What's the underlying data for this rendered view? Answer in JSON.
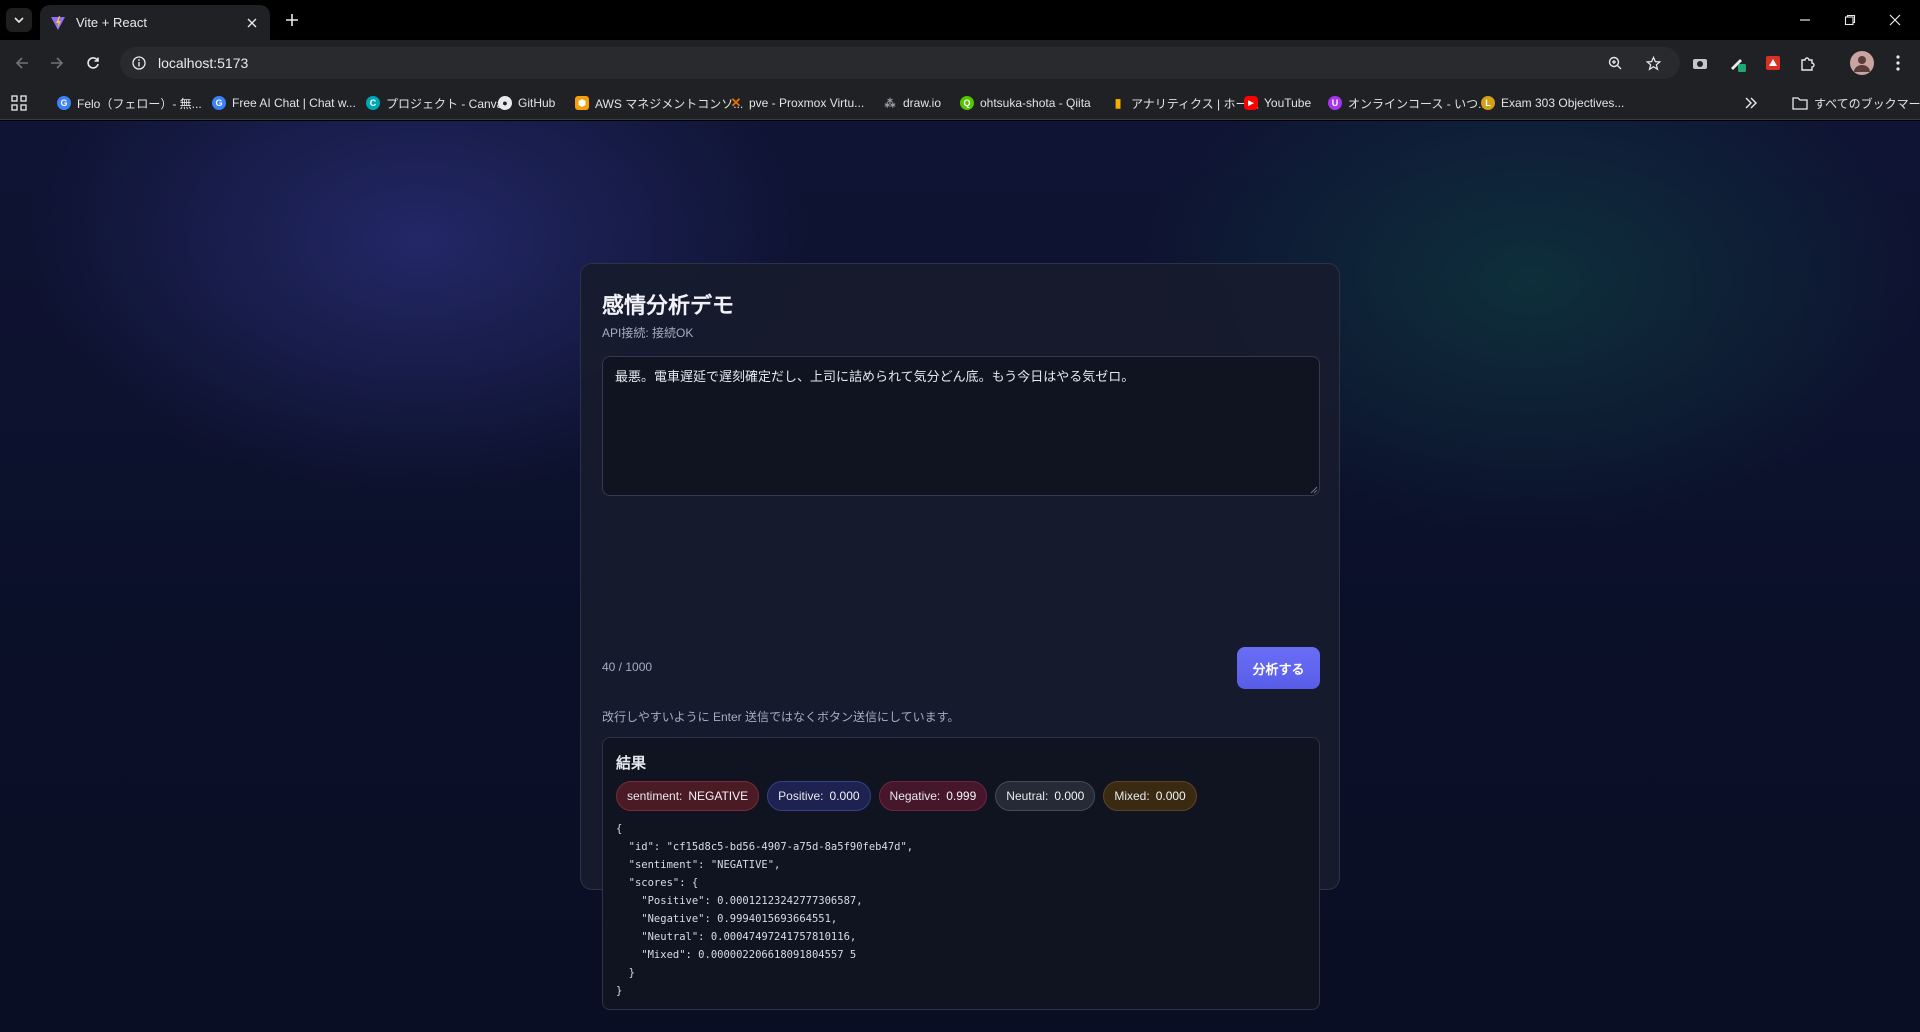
{
  "browser": {
    "tab_title": "Vite + React",
    "url": "localhost:5173",
    "bookmarks": [
      {
        "label": "Felo（フェロー）- 無...",
        "color": "#3b82f6",
        "glyph": "G"
      },
      {
        "label": "Free AI Chat | Chat w...",
        "color": "#3b82f6",
        "glyph": "G"
      },
      {
        "label": "プロジェクト - Canva",
        "color": "#00c4cc",
        "glyph": "C"
      },
      {
        "label": "GitHub",
        "color": "#ffffff",
        "glyph": "●"
      },
      {
        "label": "AWS マネジメントコンソ...",
        "color": "#f59e0b",
        "glyph": "⬢"
      },
      {
        "label": "pve - Proxmox Virtu...",
        "color": "#e57000",
        "glyph": "✕"
      },
      {
        "label": "draw.io",
        "color": "#9aa0a6",
        "glyph": "⁂"
      },
      {
        "label": "ohtsuka-shota - Qiita",
        "color": "#55c500",
        "glyph": "Q"
      },
      {
        "label": "アナリティクス | ホーム",
        "color": "#f9ab00",
        "glyph": "▮"
      },
      {
        "label": "YouTube",
        "color": "#ff0000",
        "glyph": "▶"
      },
      {
        "label": "オンラインコース - いつ...",
        "color": "#a435f0",
        "glyph": "U"
      },
      {
        "label": "Exam 303 Objectives...",
        "color": "#d4a017",
        "glyph": "L"
      }
    ],
    "all_bookmarks": "すべてのブックマーク"
  },
  "app": {
    "title": "感情分析デモ",
    "api_status": "API接続: 接続OK",
    "input_text": "最悪。電車遅延で遅刻確定だし、上司に詰められて気分どん底。もう今日はやる気ゼロ。",
    "counter": "40 / 1000",
    "analyze_label": "分析する",
    "hint": "改行しやすいように Enter 送信ではなくボタン送信にしています。"
  },
  "result": {
    "title": "結果",
    "chips": {
      "sentiment_label": "sentiment:",
      "sentiment_value": "NEGATIVE",
      "positive_label": "Positive:",
      "positive_value": "0.000",
      "negative_label": "Negative:",
      "negative_value": "0.999",
      "neutral_label": "Neutral:",
      "neutral_value": "0.000",
      "mixed_label": "Mixed:",
      "mixed_value": "0.000"
    },
    "json": "{\n  \"id\": \"cf15d8c5-bd56-4907-a75d-8a5f90feb47d\",\n  \"sentiment\": \"NEGATIVE\",\n  \"scores\": {\n    \"Positive\": 0.00012123242777306587,\n    \"Negative\": 0.9994015693664551,\n    \"Neutral\": 0.00047497241757810116,\n    \"Mixed\": 0.000002206618091804557 5\n  }\n}"
  }
}
